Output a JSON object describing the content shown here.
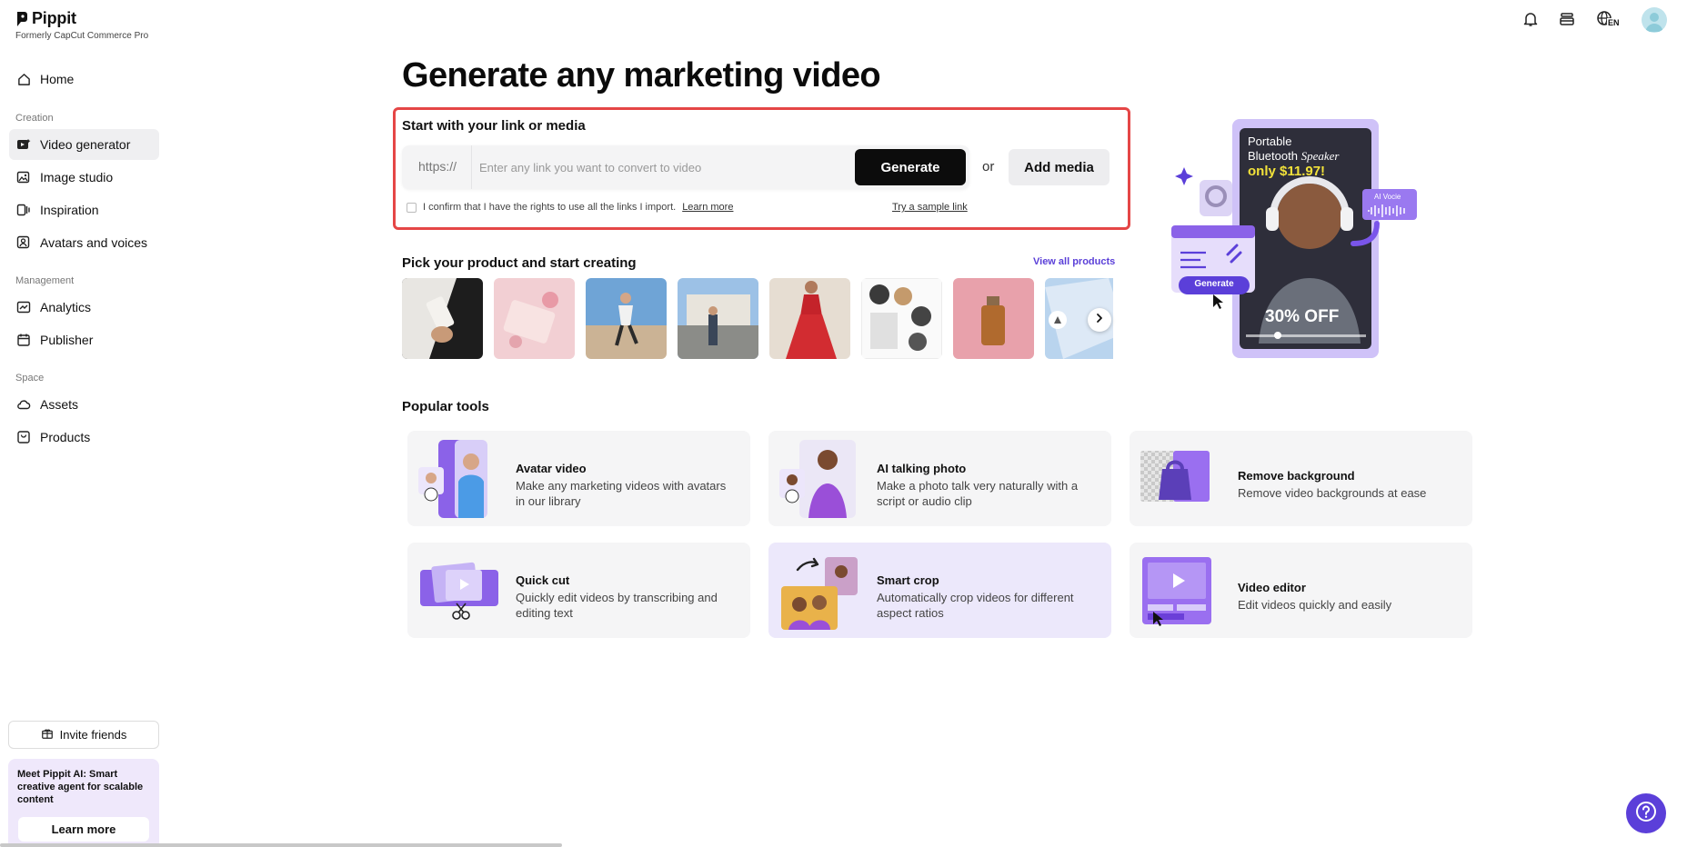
{
  "brand": {
    "name": "Pippit",
    "subtitle": "Formerly CapCut Commerce Pro"
  },
  "sidebar": {
    "home": "Home",
    "sections": {
      "creation": "Creation",
      "management": "Management",
      "space": "Space"
    },
    "items": {
      "video_generator": "Video generator",
      "image_studio": "Image studio",
      "inspiration": "Inspiration",
      "avatars_voices": "Avatars and voices",
      "analytics": "Analytics",
      "publisher": "Publisher",
      "assets": "Assets",
      "products": "Products"
    },
    "invite": "Invite friends",
    "promo": {
      "text": "Meet Pippit AI: Smart creative agent for scalable content",
      "button": "Learn more"
    }
  },
  "topbar": {
    "language_badge": "EN"
  },
  "main": {
    "headline": "Generate any marketing video",
    "link_section": {
      "title": "Start with your link or media",
      "prefix": "https://",
      "placeholder": "Enter any link you want to convert to video",
      "generate": "Generate",
      "or": "or",
      "add_media": "Add media",
      "confirm_text": "I confirm that I have the rights to use all the links I import.",
      "learn_more": "Learn more",
      "sample_link": "Try a sample link"
    },
    "products": {
      "title": "Pick your product and start creating",
      "view_all": "View all products"
    },
    "tools": {
      "title": "Popular tools",
      "items": [
        {
          "name": "Avatar video",
          "desc": "Make any marketing videos with avatars in our library"
        },
        {
          "name": "AI talking photo",
          "desc": "Make a photo talk very naturally with a script or audio clip"
        },
        {
          "name": "Remove background",
          "desc": "Remove video backgrounds at ease"
        },
        {
          "name": "Quick cut",
          "desc": "Quickly edit videos by transcribing and editing text"
        },
        {
          "name": "Smart crop",
          "desc": "Automatically crop videos for different aspect ratios"
        },
        {
          "name": "Video editor",
          "desc": "Edit videos quickly and easily"
        }
      ]
    },
    "hero": {
      "line1": "Portable",
      "line2": "Bluetooth",
      "line2_italic": "Speaker",
      "price": "only $11.97!",
      "badge": "AI Vocie",
      "generate": "Generate",
      "discount": "30% OFF"
    }
  },
  "colors": {
    "accent": "#5b3fd9",
    "highlight_border": "#e54646",
    "card_bg": "#f5f5f6"
  }
}
